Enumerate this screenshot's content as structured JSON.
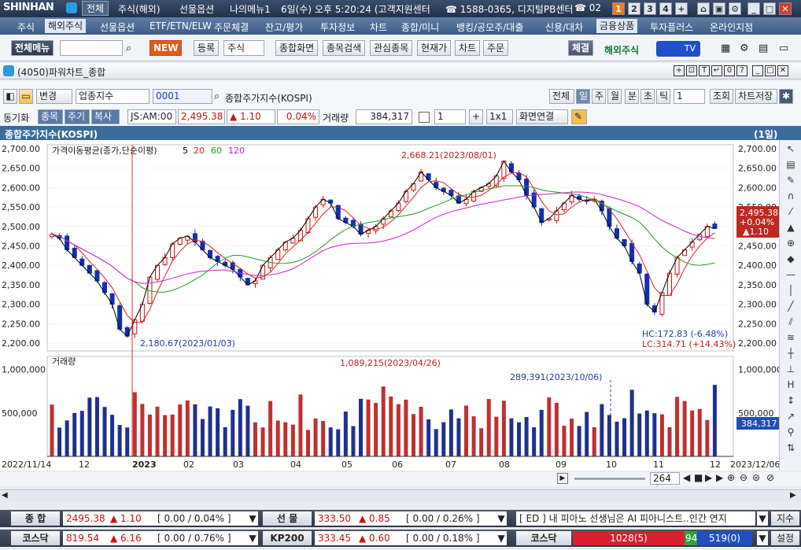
{
  "topbar": {
    "logo": "SHINHAN",
    "menu": [
      "전체",
      "주식(해외)",
      "선물옵션",
      "나의메뉴1",
      "6일(수) 오후 5:20:24 (고객지원센터",
      "☎ 1588-0365, 디지털PB센터",
      "☎ 02"
    ],
    "screens": [
      "1",
      "2",
      "3",
      "4",
      "+"
    ]
  },
  "menubar": [
    "주식",
    "해외주식",
    "선물옵션",
    "ETF/ETN/ELW",
    "주문체결",
    "잔고/평가",
    "투자정보",
    "차트",
    "종합/미니",
    "뱅킹/공모주/대출",
    "신용/대차",
    "금융상품",
    "투자플러스",
    "온라인지점"
  ],
  "toolbar": {
    "all_menu": "전체메뉴",
    "new": "NEW",
    "register": "등록",
    "stock": "주식",
    "b1": "종합화면",
    "b2": "종목검색",
    "b3": "관심종목",
    "b4": "현재가",
    "b5": "차트",
    "b6": "주문",
    "fill": "체결",
    "overseas": "해외주식",
    "tv": "TV"
  },
  "window": {
    "title": "(4050)파워차트_종합",
    "controls": [
      "+",
      "T",
      "0",
      "?"
    ]
  },
  "row2": {
    "change": "변경",
    "category": "업종지수",
    "code": "0001",
    "name": "종합주가지수(KOSPI)",
    "periods": [
      "전체",
      "일",
      "주",
      "월",
      "분",
      "초",
      "틱"
    ],
    "count": "1",
    "query": "조회",
    "save": "차트저장"
  },
  "row3": {
    "tabs": [
      "동기화",
      "종목",
      "주기",
      "복사"
    ],
    "time": "JS:AM:00",
    "price": "2,495.38",
    "change": "▲ 1.10",
    "pct": "0.04%",
    "vol_label": "거래량",
    "volume": "384,317",
    "unit": "1",
    "ratio": "1x1",
    "link": "화면연결"
  },
  "chart_header": {
    "title": "종합주가지수(KOSPI)",
    "period": "(1일)"
  },
  "chart_data": [
    {
      "type": "candlestick",
      "title": "가격이동평균(종가,단순이평)",
      "ma_periods": [
        "5",
        "20",
        "60",
        "120"
      ],
      "ma_colors": [
        "#000000",
        "#e02020",
        "#20a020",
        "#d020d0"
      ],
      "y_ticks": [
        "2,700.00",
        "2,650.00",
        "2,600.00",
        "2,550.00",
        "2,500.00",
        "2,450.00",
        "2,400.00",
        "2,350.00",
        "2,300.00",
        "2,250.00",
        "2,200.00"
      ],
      "ylim": [
        2180,
        2710
      ],
      "x_ticks": [
        "12",
        "2023",
        "02",
        "03",
        "04",
        "05",
        "06",
        "07",
        "08",
        "09",
        "10",
        "11",
        "12"
      ],
      "x_start": "2022/11/14",
      "x_end": "2023/12/06",
      "annotations": {
        "high": "2,668.21(2023/08/01)",
        "low": "2,180.67(2023/01/03)",
        "hc": "HC:172.83 (-6.48%)",
        "lc": "LC:314.71 (+14.43%)"
      },
      "last": {
        "price": "2,495.38",
        "pct": "+0.04%",
        "chg": "▲1.10"
      },
      "close_series": [
        2480,
        2470,
        2440,
        2420,
        2400,
        2380,
        2360,
        2330,
        2300,
        2236,
        2218,
        2260,
        2300,
        2370,
        2400,
        2420,
        2455,
        2470,
        2475,
        2460,
        2440,
        2420,
        2410,
        2400,
        2390,
        2370,
        2350,
        2360,
        2400,
        2420,
        2440,
        2460,
        2470,
        2490,
        2520,
        2550,
        2570,
        2560,
        2520,
        2510,
        2500,
        2480,
        2490,
        2500,
        2520,
        2540,
        2560,
        2590,
        2610,
        2640,
        2620,
        2600,
        2590,
        2580,
        2560,
        2570,
        2590,
        2600,
        2610,
        2630,
        2668,
        2640,
        2620,
        2580,
        2550,
        2510,
        2520,
        2540,
        2560,
        2580,
        2570,
        2565,
        2570,
        2540,
        2500,
        2470,
        2450,
        2410,
        2380,
        2300,
        2280,
        2330,
        2380,
        2420,
        2440,
        2460,
        2480,
        2500,
        2495
      ]
    },
    {
      "type": "bar",
      "title": "거래량",
      "y_ticks": [
        "1,000,000",
        "500,000"
      ],
      "annotations": {
        "max": "1,089,215(2023/04/26)",
        "point": "289,391(2023/10/06)"
      },
      "last_volume": "384,317"
    }
  ],
  "scroll": {
    "count": "264"
  },
  "bottom": {
    "rows": [
      [
        {
          "label": "종 합",
          "value": "2495.38",
          "chg": "▲ 1.10",
          "pct": "[ 0.00 / 0.04% ]"
        },
        {
          "label": "선 물",
          "value": "333.50",
          "chg": "▲ 0.85",
          "pct": "[ 0.00 / 0.26% ]"
        }
      ],
      [
        {
          "label": "코스닥",
          "value": "819.54",
          "chg": "▲ 6.16",
          "pct": "[ 0.00 / 0.76% ]"
        },
        {
          "label": "KP200",
          "value": "333.45",
          "chg": "▲ 0.60",
          "pct": "[ 0.00 / 0.18% ]"
        }
      ]
    ],
    "news": "[ ED ] 내 피아노 선생님은 AI 피아니스트..인간 연지",
    "index_btn": "지수",
    "kosdaq_label": "코스닥",
    "up": "1028(5)",
    "flat": "94",
    "down": "519(0)",
    "settings": "설정"
  }
}
